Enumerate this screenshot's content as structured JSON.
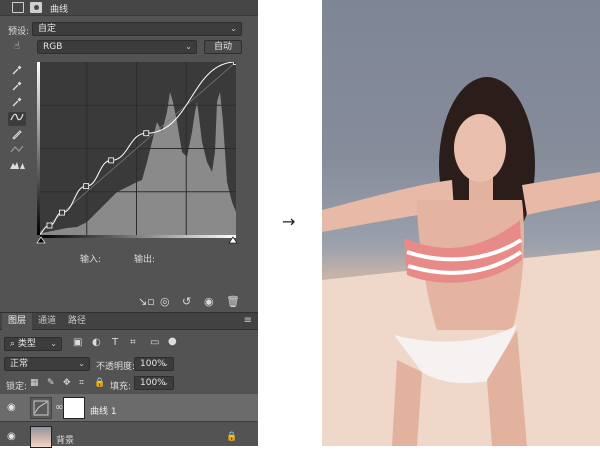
{
  "panel": {
    "title": "曲线",
    "preset_label": "预设:",
    "preset_value": "自定",
    "channel_value": "RGB",
    "auto_button": "自动",
    "input_label": "输入:",
    "output_label": "输出:"
  },
  "layers_panel": {
    "tabs": [
      "图层",
      "通道",
      "路径"
    ],
    "filter_label": "类型",
    "blend_mode": "正常",
    "opacity_label": "不透明度:",
    "opacity_value": "100%",
    "lock_label": "锁定:",
    "fill_label": "填充:",
    "fill_value": "100%",
    "layers": [
      {
        "name": "曲线 1",
        "selected": true
      },
      {
        "name": "背景",
        "selected": false
      }
    ]
  },
  "arrow": "→",
  "colors": {
    "panel_bg": "#535353",
    "graph_bg": "#3a3a3a",
    "histogram": "#8a8a8a",
    "selected_layer": "#6b6b6b"
  },
  "curve_points": [
    {
      "input": 0,
      "output": 0
    },
    {
      "input": 16,
      "output": 14
    },
    {
      "input": 32,
      "output": 33
    },
    {
      "input": 63,
      "output": 72
    },
    {
      "input": 95,
      "output": 110
    },
    {
      "input": 140,
      "output": 150
    },
    {
      "input": 255,
      "output": 255
    }
  ]
}
